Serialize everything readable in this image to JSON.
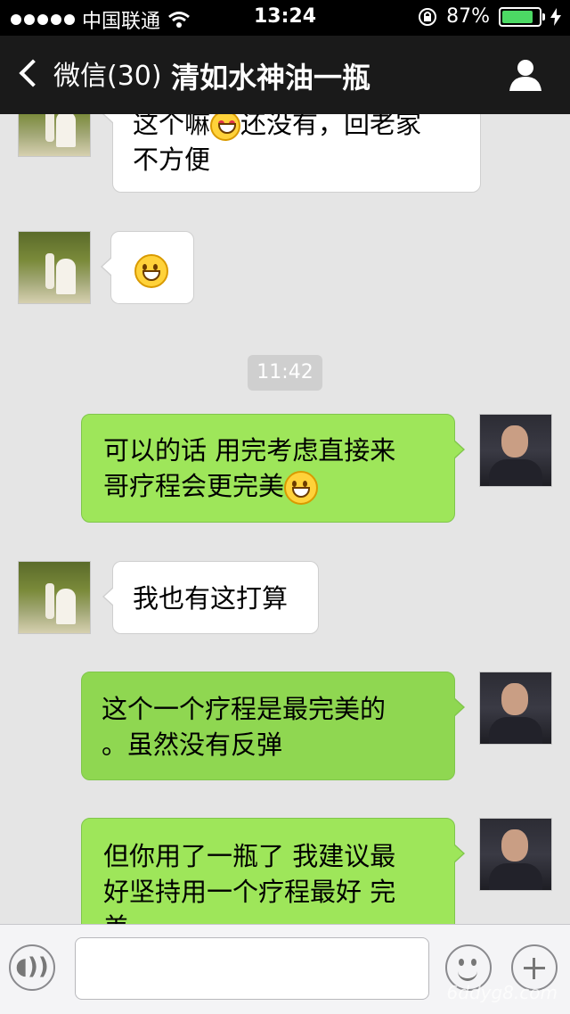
{
  "status_bar": {
    "carrier": "中国联通",
    "time": "13:24",
    "battery_percent": "87%",
    "battery_level": 0.87,
    "icons": [
      "signal-dots-icon",
      "wifi-icon",
      "rotation-lock-icon",
      "battery-icon",
      "charging-icon"
    ]
  },
  "nav": {
    "back_label": "微信(30)",
    "title": "清如水神油一瓶",
    "profile_icon": "person-icon"
  },
  "messages": [
    {
      "side": "left",
      "text_lines": [
        "这个嘛",
        "还没有，回老家",
        "不方便"
      ],
      "emoji": "heart-eyes-emoji"
    },
    {
      "side": "left",
      "text_lines": [],
      "emoji": "grin-emoji"
    },
    {
      "timestamp": "11:42"
    },
    {
      "side": "right",
      "text_lines": [
        "可以的话  用完考虑直接来",
        "哥疗程会更完美"
      ],
      "emoji": "smile-emoji"
    },
    {
      "side": "left",
      "text_lines": [
        "我也有这打算"
      ]
    },
    {
      "side": "right",
      "text_lines": [
        "这个一个疗程是最完美的",
        "。虽然没有反弹"
      ]
    },
    {
      "side": "right",
      "text_lines": [
        "但你用了一瓶了 我建议最",
        "好坚持用一个疗程最好 完",
        "美"
      ]
    }
  ],
  "input_bar": {
    "voice_icon": "voice-icon",
    "input_value": "",
    "emoji_icon": "emoji-icon",
    "plus_icon": "plus-icon"
  },
  "watermark": "6ddyg8.com",
  "colors": {
    "background": "#e5e5e5",
    "nav_bg": "#1a1a1a",
    "own_bubble": "#9ee65a",
    "other_bubble": "#ffffff"
  }
}
